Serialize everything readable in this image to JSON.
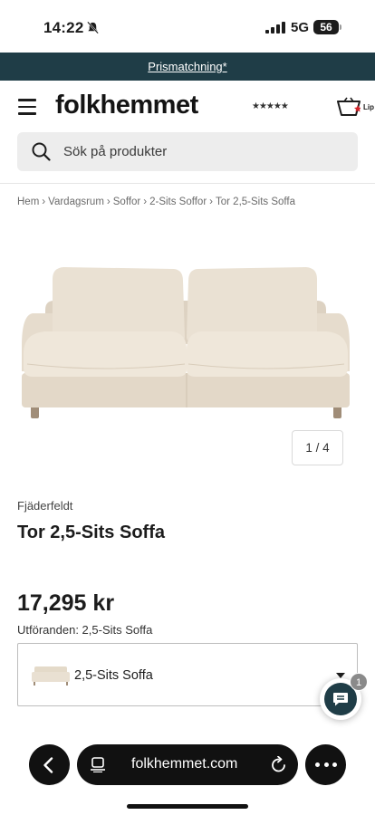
{
  "status_bar": {
    "time": "14:22",
    "network": "5G",
    "battery": "56"
  },
  "promo": {
    "text": "Prismatchning*"
  },
  "header": {
    "logo": "folkhemmet",
    "rating_stars": "★★★★★",
    "cart_label": "Lip"
  },
  "search": {
    "placeholder": "Sök på produkter"
  },
  "breadcrumb": {
    "items": [
      "Hem",
      "Vardagsrum",
      "Soffor",
      "2-Sits Soffor",
      "Tor 2,5-Sits Soffa"
    ],
    "separator": "›"
  },
  "gallery": {
    "pager": "1 / 4"
  },
  "product": {
    "brand": "Fjäderfeldt",
    "title": "Tor 2,5-Sits Soffa",
    "price": "17,295 kr",
    "variant_label": "Utföranden: 2,5-Sits Soffa",
    "variant_value": "2,5-Sits Soffa"
  },
  "chat": {
    "badge": "1"
  },
  "browser": {
    "url": "folkhemmet.com"
  },
  "colors": {
    "banner": "#1f3d47",
    "sofa": "#e6dccd",
    "toolbar": "#111111"
  }
}
